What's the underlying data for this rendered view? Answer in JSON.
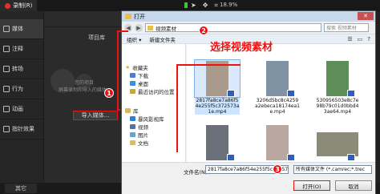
{
  "app": {
    "record_label": "录制(R)",
    "zoom": "18.9%",
    "library_title": "项目库",
    "import_label": "导入媒体...",
    "hint_line1": "您的项目",
    "hint_line2": "屏幕录制和导入的媒体",
    "other_tab": "其它",
    "sidebar": [
      {
        "label": "媒体",
        "icon": "media-icon"
      },
      {
        "label": "注释",
        "icon": "annotation-icon"
      },
      {
        "label": "转场",
        "icon": "transition-icon"
      },
      {
        "label": "行为",
        "icon": "behavior-icon"
      },
      {
        "label": "动画",
        "icon": "animation-icon"
      },
      {
        "label": "指针效果",
        "icon": "cursor-effect-icon"
      }
    ]
  },
  "dialog": {
    "title": "打开",
    "close": "✕",
    "path": "视频素材",
    "search_placeholder": "搜索 视频素材",
    "organize": "组织 ▾",
    "new_folder": "新建文件夹",
    "nav": {
      "favorites": "收藏夹",
      "items": [
        "下载",
        "桌面",
        "最近访问的位置"
      ],
      "library": "库",
      "library_items": [
        "暴风影视库",
        "视频",
        "图片",
        "文档"
      ]
    },
    "files": [
      {
        "name": "2817fa8ce7a86f54e255f5c372573a1e.mp4",
        "selected": true,
        "color": "#a99a8c"
      },
      {
        "name": "3206d5bc8c4259a2ebeca18174ea1e.mp4",
        "selected": false,
        "color": "#7f93a5"
      },
      {
        "name": "530956503e8c7e98b79c01d0bbd43ae64.mp4",
        "selected": false,
        "color": "#5e8e5a"
      },
      {
        "name": "",
        "selected": false,
        "color": "#6b6f7a"
      },
      {
        "name": "",
        "selected": false,
        "color": "#b8a8a0"
      },
      {
        "name": "",
        "selected": false,
        "color": "#8c8a78"
      }
    ],
    "filename_label": "文件名(N):",
    "filename_value": "2817fa8ce7a86f54e255f5c372573a1e.mp4",
    "filetype_value": "所有媒体文件 (*.camrec;*.trec",
    "open_button": "打开(O)",
    "cancel_button": "取消"
  },
  "annotations": {
    "caption": "选择视频素材",
    "step1": "1",
    "step2": "2",
    "step3": "3"
  },
  "colors": {
    "accent_red": "#e11111",
    "dialog_title_bg": "#c8d8ec",
    "selection_blue": "#cce4ff"
  }
}
